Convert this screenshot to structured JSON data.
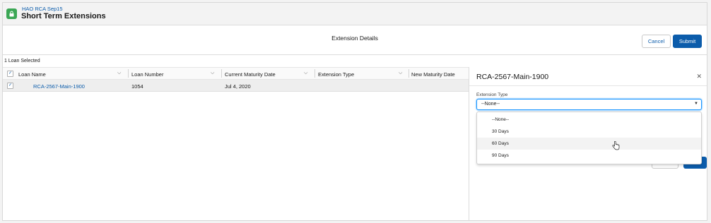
{
  "app": {
    "subtitle": "HAO RCA Sep15",
    "title": "Short Term Extensions"
  },
  "action_bar": {
    "title": "Extension Details",
    "cancel_label": "Cancel",
    "submit_label": "Submit"
  },
  "selection": {
    "count_text": "1 Loan Selected"
  },
  "table": {
    "columns": [
      "Loan Name",
      "Loan Number",
      "Current Maturity Date",
      "Extension Type",
      "New Maturity Date"
    ],
    "rows": [
      {
        "loan_name": "RCA-2567-Main-1900",
        "loan_number": "1054",
        "current_maturity": "Jul 4, 2020",
        "extension_type": "",
        "new_maturity": ""
      }
    ]
  },
  "panel": {
    "title": "RCA-2567-Main-1900",
    "field_label": "Extension Type",
    "selected_value": "--None--",
    "options": [
      "--None--",
      "30 Days",
      "60 Days",
      "90 Days"
    ],
    "hovered_option": "60 Days"
  },
  "colors": {
    "brand": "#0b5cab",
    "app_icon": "#3ba755",
    "focus": "#1b96ff"
  },
  "icons": {
    "app": "lock-icon",
    "close": "close-icon",
    "sort": "chevron-down-icon",
    "cursor": "hand-pointer-icon"
  }
}
